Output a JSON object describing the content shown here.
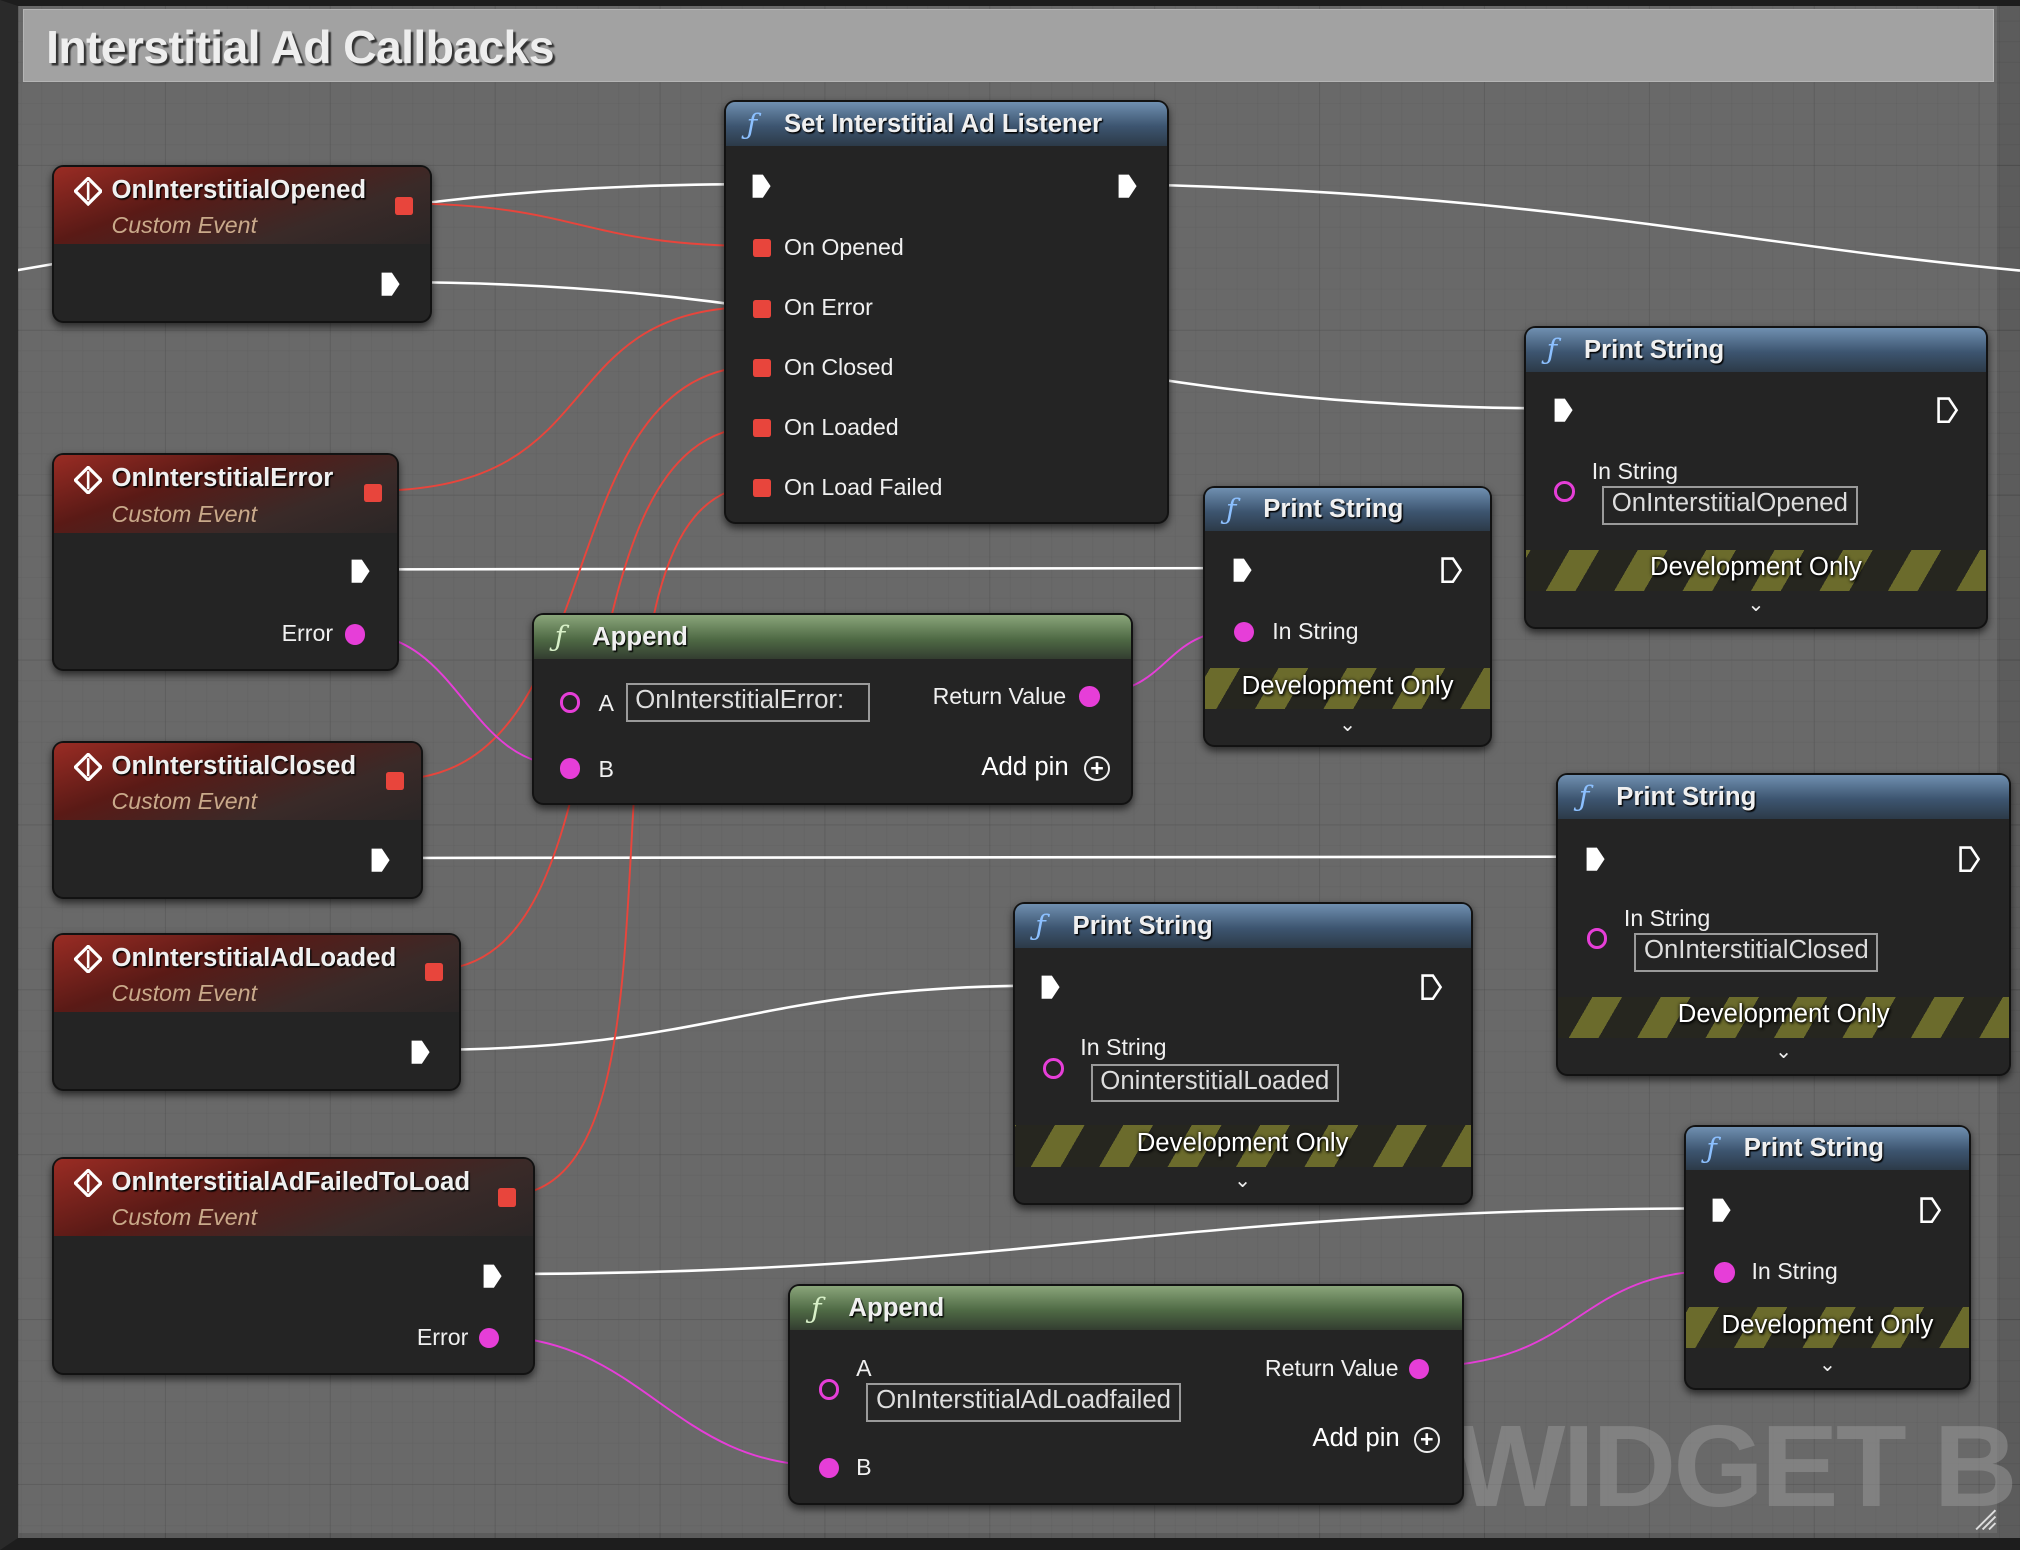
{
  "comment": {
    "title": "Interstitial Ad Callbacks"
  },
  "watermark": "WIDGET B",
  "colors": {
    "exec_wire": "#ffffff",
    "delegate_wire": "#e8453c",
    "string_wire": "#e63ed8",
    "event_header": "#9a2c24",
    "function_header": "#5a7fa8",
    "pure_header": "#6a8a5a"
  },
  "events": [
    {
      "title": "OnInterstitialOpened",
      "subtitle": "Custom Event"
    },
    {
      "title": "OnInterstitialError",
      "subtitle": "Custom Event",
      "output": "Error"
    },
    {
      "title": "OnInterstitialClosed",
      "subtitle": "Custom Event"
    },
    {
      "title": "OnInterstitialAdLoaded",
      "subtitle": "Custom Event"
    },
    {
      "title": "OnInterstitialAdFailedToLoad",
      "subtitle": "Custom Event",
      "output": "Error"
    }
  ],
  "listener": {
    "title": "Set Interstitial Ad Listener",
    "pins": [
      "On Opened",
      "On Error",
      "On Closed",
      "On Loaded",
      "On Load Failed"
    ]
  },
  "append1": {
    "title": "Append",
    "a_label": "A",
    "a_value": "OnInterstitialError:",
    "b_label": "B",
    "return_label": "Return Value",
    "add_pin": "Add pin"
  },
  "append2": {
    "title": "Append",
    "a_label": "A",
    "a_value": "OnInterstitialAdLoadfailed",
    "b_label": "B",
    "return_label": "Return Value",
    "add_pin": "Add pin"
  },
  "print": [
    {
      "title": "Print String",
      "in_label": "In String",
      "dev": "Development Only"
    },
    {
      "title": "Print String",
      "in_label": "In String",
      "value": "OnInterstitialOpened",
      "dev": "Development Only"
    },
    {
      "title": "Print String",
      "in_label": "In String",
      "value": "OnInterstitialClosed",
      "dev": "Development Only"
    },
    {
      "title": "Print String",
      "in_label": "In String",
      "value": "OninterstitialLoaded",
      "dev": "Development Only"
    },
    {
      "title": "Print String",
      "in_label": "In String",
      "dev": "Development Only"
    }
  ],
  "icons": {
    "event": "event-diamond-icon",
    "function": "function-f-icon",
    "exec": "exec-pin-icon",
    "add": "plus-circle-icon",
    "chevron": "chevron-down-icon"
  }
}
